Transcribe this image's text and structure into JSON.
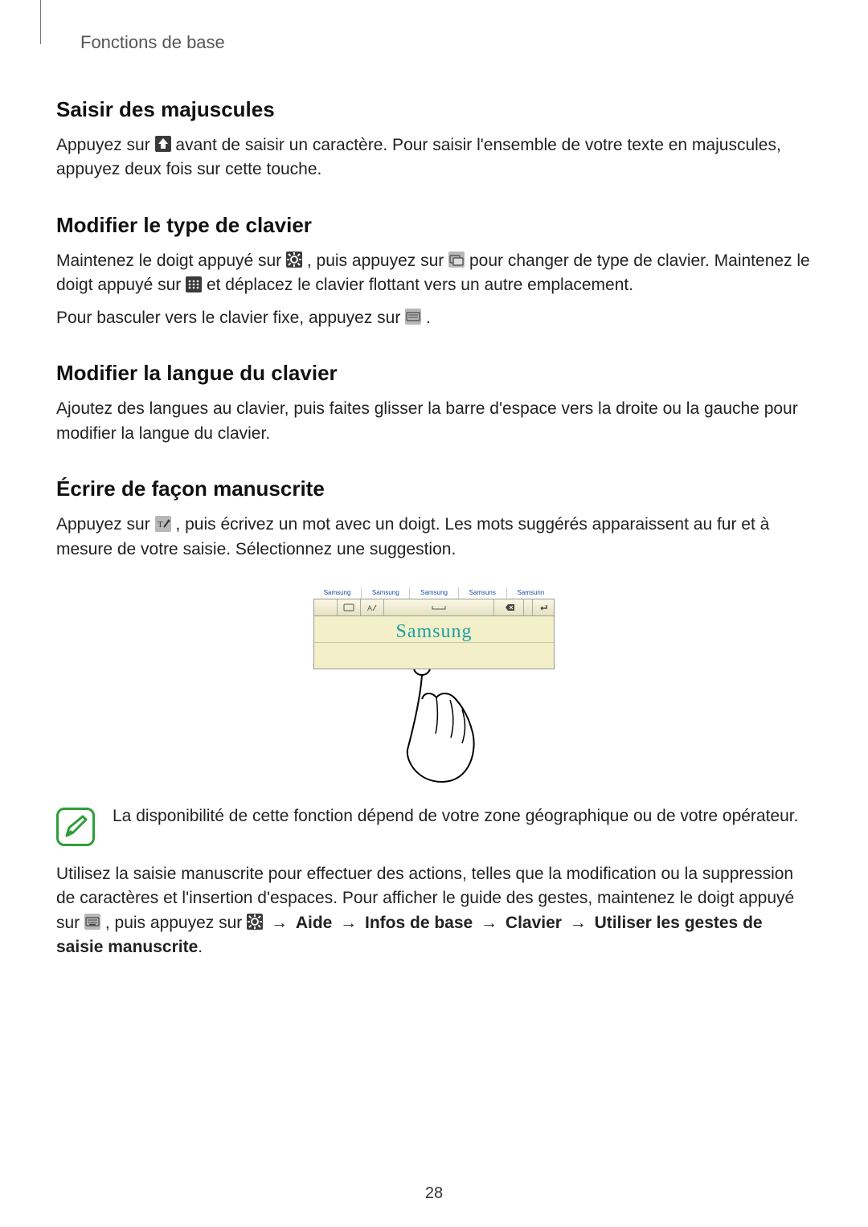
{
  "runningHead": "Fonctions de base",
  "pageNumber": "28",
  "sections": {
    "s1": {
      "title": "Saisir des majuscules",
      "p1a": "Appuyez sur ",
      "p1b": " avant de saisir un caractère. Pour saisir l'ensemble de votre texte en majuscules, appuyez deux fois sur cette touche."
    },
    "s2": {
      "title": "Modifier le type de clavier",
      "p1a": "Maintenez le doigt appuyé sur ",
      "p1b": ", puis appuyez sur ",
      "p1c": " pour changer de type de clavier. Maintenez le doigt appuyé sur ",
      "p1d": " et déplacez le clavier flottant vers un autre emplacement.",
      "p2a": "Pour basculer vers le clavier fixe, appuyez sur ",
      "p2b": "."
    },
    "s3": {
      "title": "Modifier la langue du clavier",
      "p1": "Ajoutez des langues au clavier, puis faites glisser la barre d'espace vers la droite ou la gauche pour modifier la langue du clavier."
    },
    "s4": {
      "title": "Écrire de façon manuscrite",
      "p1a": "Appuyez sur ",
      "p1b": ", puis écrivez un mot avec un doigt. Les mots suggérés apparaissent au fur et à mesure de votre saisie. Sélectionnez une suggestion.",
      "note": "La disponibilité de cette fonction dépend de votre zone géographique ou de votre opérateur.",
      "p2a": "Utilisez la saisie manuscrite pour effectuer des actions, telles que la modification ou la suppression de caractères et l'insertion d'espaces. Pour afficher le guide des gestes, maintenez le doigt appuyé sur ",
      "p2b": ", puis appuyez sur ",
      "arrow": " → ",
      "bold1": "Aide",
      "bold2": "Infos de base",
      "bold3": "Clavier",
      "bold4": "Utiliser les gestes de saisie manuscrite",
      "p2c": "."
    }
  },
  "figure": {
    "suggestions": [
      "Samsung",
      "Samsung",
      "Samsung",
      "Samsuns",
      "Samsunn"
    ],
    "handwriting": "Samsung"
  }
}
